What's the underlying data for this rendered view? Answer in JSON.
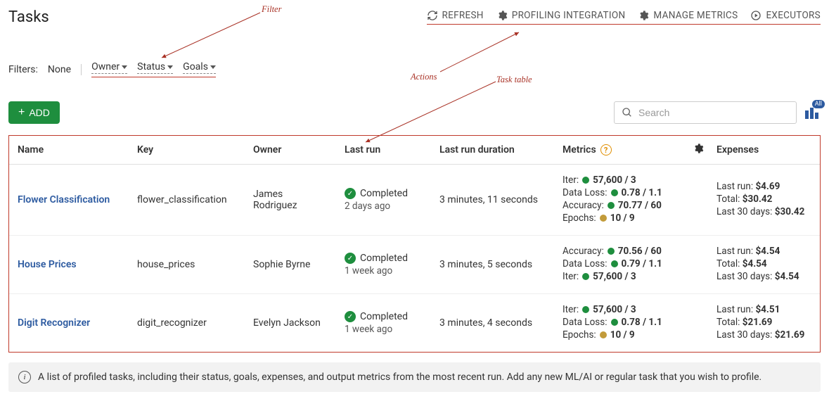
{
  "page_title": "Tasks",
  "annotations": {
    "filter": "Filter",
    "actions": "Actions",
    "task_table": "Task table"
  },
  "actions": {
    "refresh": "REFRESH",
    "profiling_integration": "PROFILING INTEGRATION",
    "manage_metrics": "MANAGE METRICS",
    "executors": "EXECUTORS"
  },
  "filters": {
    "label": "Filters:",
    "value": "None",
    "owner": "Owner",
    "status": "Status",
    "goals": "Goals"
  },
  "buttons": {
    "add": "ADD"
  },
  "search": {
    "placeholder": "Search"
  },
  "columns_badge": "All",
  "table": {
    "headers": {
      "name": "Name",
      "key": "Key",
      "owner": "Owner",
      "last_run": "Last run",
      "last_run_duration": "Last run duration",
      "metrics": "Metrics",
      "expenses": "Expenses"
    },
    "rows": [
      {
        "name": "Flower Classification",
        "key": "flower_classification",
        "owner": "James Rodriguez",
        "status": "Completed",
        "when": "2 days ago",
        "duration": "3 minutes, 11 seconds",
        "metrics": [
          {
            "label": "Iter:",
            "dot": "green",
            "value": "57,600 / 3"
          },
          {
            "label": "Data Loss:",
            "dot": "green",
            "value": "0.78 / 1.1"
          },
          {
            "label": "Accuracy:",
            "dot": "green",
            "value": "70.77 / 60"
          },
          {
            "label": "Epochs:",
            "dot": "amber",
            "value": "10 / 9"
          }
        ],
        "expenses": {
          "last_run_label": "Last run:",
          "last_run": "$4.69",
          "total_label": "Total:",
          "total": "$30.42",
          "last30_label": "Last 30 days:",
          "last30": "$30.42"
        }
      },
      {
        "name": "House Prices",
        "key": "house_prices",
        "owner": "Sophie Byrne",
        "status": "Completed",
        "when": "1 week ago",
        "duration": "3 minutes, 5 seconds",
        "metrics": [
          {
            "label": "Accuracy:",
            "dot": "green",
            "value": "70.56 / 60"
          },
          {
            "label": "Data Loss:",
            "dot": "green",
            "value": "0.79 / 1.1"
          },
          {
            "label": "Iter:",
            "dot": "green",
            "value": "57,600 / 3"
          }
        ],
        "expenses": {
          "last_run_label": "Last run:",
          "last_run": "$4.54",
          "total_label": "Total:",
          "total": "$4.54",
          "last30_label": "Last 30 days:",
          "last30": "$4.54"
        }
      },
      {
        "name": "Digit Recognizer",
        "key": "digit_recognizer",
        "owner": "Evelyn Jackson",
        "status": "Completed",
        "when": "1 week ago",
        "duration": "3 minutes, 4 seconds",
        "metrics": [
          {
            "label": "Iter:",
            "dot": "green",
            "value": "57,600 / 3"
          },
          {
            "label": "Data Loss:",
            "dot": "green",
            "value": "0.78 / 1.1"
          },
          {
            "label": "Epochs:",
            "dot": "amber",
            "value": "10 / 9"
          }
        ],
        "expenses": {
          "last_run_label": "Last run:",
          "last_run": "$4.51",
          "total_label": "Total:",
          "total": "$21.69",
          "last30_label": "Last 30 days:",
          "last30": "$21.69"
        }
      }
    ]
  },
  "info_text": "A list of profiled tasks, including their status, goals, expenses, and output metrics from the most recent run. Add any new ML/AI or regular task that you wish to profile."
}
